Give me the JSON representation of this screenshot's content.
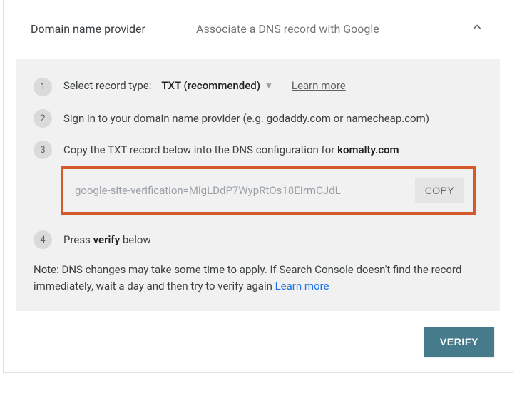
{
  "header": {
    "title": "Domain name provider",
    "subtitle": "Associate a DNS record with Google"
  },
  "step1": {
    "num": "1",
    "label": "Select record type:",
    "selected": "TXT (recommended)",
    "learn": "Learn more"
  },
  "step2": {
    "num": "2",
    "text": "Sign in to your domain name provider (e.g. godaddy.com or namecheap.com)"
  },
  "step3": {
    "num": "3",
    "prefix": "Copy the TXT record below into the DNS configuration for ",
    "domain": "komalty.com",
    "record_value": "google-site-verification=MigLDdP7WypRtOs18EIrmCJdL",
    "copy_label": "COPY"
  },
  "step4": {
    "num": "4",
    "prefix": "Press ",
    "bold": "verify",
    "suffix": " below"
  },
  "note": {
    "text": "Note: DNS changes may take some time to apply. If Search Console doesn't find the record immediately, wait a day and then try to verify again ",
    "learn": "Learn more"
  },
  "footer": {
    "verify_label": "VERIFY"
  }
}
